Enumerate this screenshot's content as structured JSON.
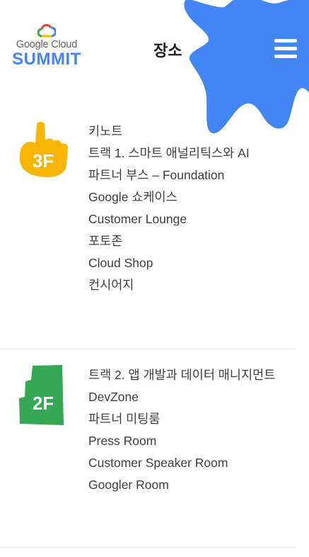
{
  "header": {
    "logo_line1": "Google Cloud",
    "logo_line2": "SUMMIT",
    "title": "장소",
    "menu_icon": "hamburger-menu-icon"
  },
  "colors": {
    "brand_blue": "#4285f4",
    "floor_3f": "#f9b600",
    "floor_2f": "#34a853"
  },
  "floors": [
    {
      "badge": "3F",
      "icon": "pointing-hand-icon",
      "rooms": [
        "키노트",
        "트랙 1. 스마트 애널리틱스와 AI",
        "파트너 부스 – Foundation",
        "Google 쇼케이스",
        "Customer Lounge",
        "포토존",
        "Cloud Shop",
        "컨시어지"
      ]
    },
    {
      "badge": "2F",
      "icon": "stairs-icon",
      "rooms": [
        "트랙 2. 앱 개발과 데이터 매니지먼트",
        "DevZone",
        "파트너 미팅룸",
        "Press Room",
        "Customer Speaker Room",
        "Googler Room"
      ]
    }
  ]
}
